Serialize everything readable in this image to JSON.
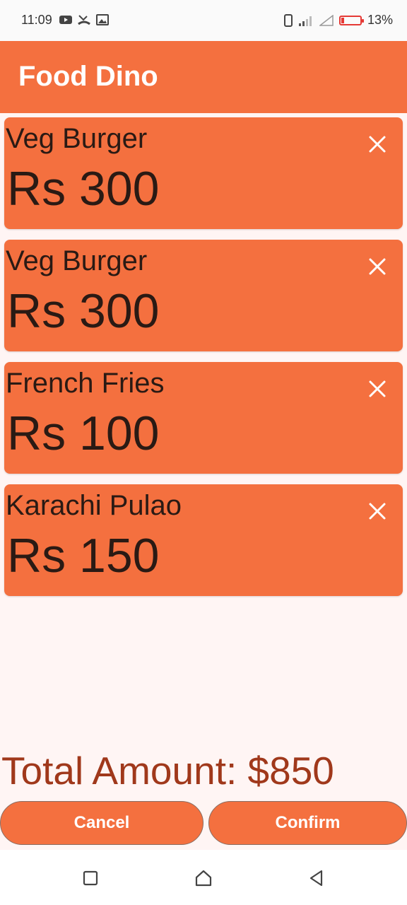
{
  "status_bar": {
    "time": "11:09",
    "battery_percent": "13%",
    "icons": [
      "youtube-icon",
      "missed-call-icon",
      "image-icon",
      "phone-icon",
      "signal-icon",
      "wifi-off-icon",
      "battery-low-icon"
    ]
  },
  "app_bar": {
    "title": "Food Dino"
  },
  "cart": {
    "items": [
      {
        "name": "Veg Burger",
        "price": "Rs 300"
      },
      {
        "name": "Veg Burger",
        "price": "Rs 300"
      },
      {
        "name": "French Fries",
        "price": "Rs 100"
      },
      {
        "name": "Karachi Pulao",
        "price": "Rs 150"
      }
    ],
    "total": "Total Amount: $850"
  },
  "actions": {
    "cancel_label": "Cancel",
    "confirm_label": "Confirm"
  },
  "nav_bar": {
    "icons": [
      "recent-apps-icon",
      "home-icon",
      "back-icon"
    ]
  },
  "colors": {
    "primary": "#f4703f",
    "background": "#fff5f4",
    "total_text": "#a0381b"
  }
}
